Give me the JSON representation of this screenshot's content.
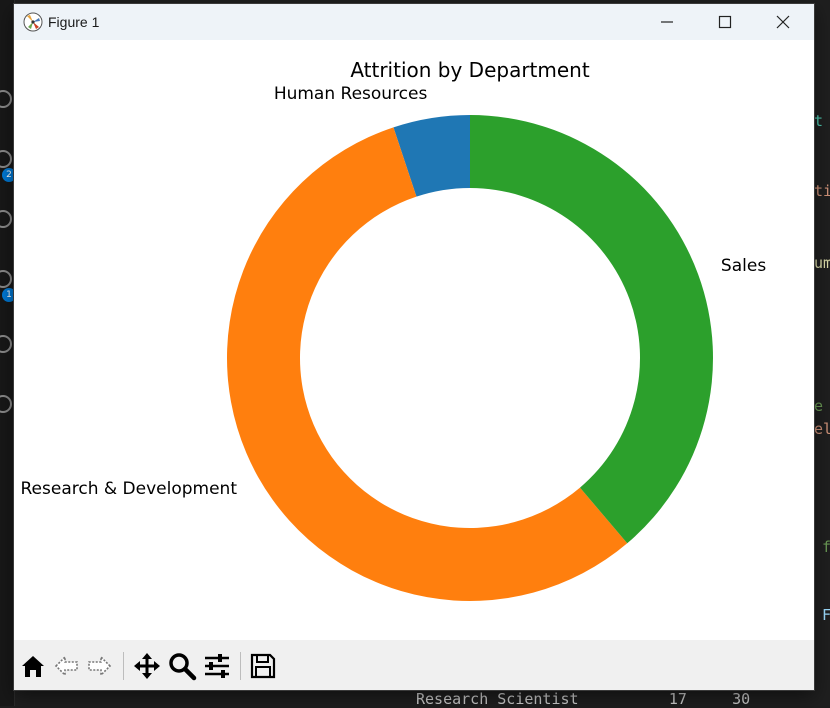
{
  "window": {
    "title": "Figure 1",
    "controls": [
      "minimize",
      "maximize",
      "close"
    ]
  },
  "background_editor": {
    "bottom_line": "Research Scientist          17     30",
    "fragments": [
      "t",
      "ti",
      "um",
      "e",
      "el",
      "f",
      "F"
    ],
    "badges": [
      "2",
      "1"
    ]
  },
  "toolbar": {
    "buttons": [
      "home-icon",
      "back-icon",
      "forward-icon",
      "pan-icon",
      "zoom-icon",
      "configure-icon",
      "save-icon"
    ]
  },
  "chart_data": {
    "type": "pie",
    "donut": true,
    "title": "Attrition by Department",
    "start_angle_deg": 90,
    "direction": "counterclockwise",
    "slices": [
      {
        "label": "Human Resources",
        "value": 5.1,
        "color": "#1f77b4"
      },
      {
        "label": "Research & Development",
        "value": 56.1,
        "color": "#ff7f0e"
      },
      {
        "label": "Sales",
        "value": 38.8,
        "color": "#2ca02c"
      }
    ]
  }
}
